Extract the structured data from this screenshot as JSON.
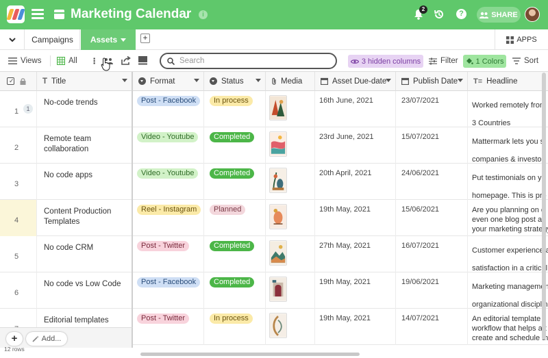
{
  "header": {
    "app_title": "Marketing Calendar",
    "notifications_count": "2",
    "share_label": "SHARE",
    "brand_color": "#5fc86b",
    "icons": [
      "logo-icon",
      "hamburger-menu-icon",
      "table-file-icon",
      "chevron-down-icon",
      "info-icon",
      "bell-icon",
      "history-icon",
      "help-icon",
      "users-icon",
      "avatar"
    ]
  },
  "tabs": {
    "items": [
      {
        "label": "Campaigns",
        "active": false
      },
      {
        "label": "Assets",
        "active": true
      }
    ],
    "add_label": "+",
    "apps_label": "APPS"
  },
  "toolbar": {
    "views_label": "Views",
    "view_name": "All",
    "search_placeholder": "Search",
    "hidden_columns_label": "3 hidden columns",
    "filter_label": "Filter",
    "colors_label": "1 Colors",
    "sort_label": "Sort"
  },
  "columns": [
    "Title",
    "Format",
    "Status",
    "Media",
    "Asset Due-date",
    "Publish Date",
    "Headline"
  ],
  "rows": [
    {
      "num": "1",
      "comments": "1",
      "title": "No-code trends",
      "format": "Post - Facebook",
      "status": "In process",
      "due": "16th June, 2021",
      "publish": "23/07/2021",
      "headline": [
        "Worked remotely from",
        "",
        "3 Countries"
      ]
    },
    {
      "num": "2",
      "comments": "",
      "title": "Remote team collaboration",
      "format": "Video - Youtube",
      "status": "Completed",
      "due": "23rd June, 2021",
      "publish": "15/07/2021",
      "headline": [
        "Mattermark lets you s",
        "",
        "companies & investor"
      ]
    },
    {
      "num": "3",
      "comments": "",
      "title": "No code apps",
      "format": "Video - Youtube",
      "status": "Completed",
      "due": "20th April, 2021",
      "publish": "24/06/2021",
      "headline": [
        "Put testimonials on yo",
        "",
        "homepage. This is pro"
      ]
    },
    {
      "num": "4",
      "comments": "",
      "title": "Content Production Templates",
      "format": "Reel - Instagram",
      "status": "Planned",
      "due": "19th May, 2021",
      "publish": "15/06/2021",
      "headline": [
        "Are you planning on c",
        "even one blog post as p",
        "your marketing strategy"
      ]
    },
    {
      "num": "5",
      "comments": "",
      "title": "No code CRM",
      "format": "Post - Twitter",
      "status": "Completed",
      "due": "27th May, 2021",
      "publish": "16/07/2021",
      "headline": [
        "Customer experience a",
        "",
        "satisfaction in a critical"
      ]
    },
    {
      "num": "6",
      "comments": "",
      "title": "No code vs Low Code",
      "format": "Post - Facebook",
      "status": "Completed",
      "due": "19th May, 2021",
      "publish": "19/06/2021",
      "headline": [
        "Marketing managemen",
        "",
        "organizational disciplin"
      ]
    },
    {
      "num": "7",
      "comments": "",
      "title": "Editorial templates",
      "format": "Post - Twitter",
      "status": "In process",
      "due": "19th May, 2021",
      "publish": "14/07/2021",
      "headline": [
        "An editorial template i",
        "workflow that helps a t",
        "create and schedule th"
      ]
    }
  ],
  "format_colors": {
    "Post - Facebook": {
      "bg": "#cfdff5",
      "fg": "#2a4d7a"
    },
    "Video - Youtube": {
      "bg": "#d2f2c8",
      "fg": "#2e6b26"
    },
    "Reel - Instagram": {
      "bg": "#fbeaa8",
      "fg": "#6b5410"
    },
    "Post - Twitter": {
      "bg": "#f8d3dc",
      "fg": "#7a2a3c"
    }
  },
  "status_colors": {
    "In process": {
      "bg": "#fbeaa8",
      "fg": "#6b5410"
    },
    "Completed": {
      "bg": "#4cb648",
      "fg": "#ffffff"
    },
    "Planned": {
      "bg": "#f3d7dc",
      "fg": "#7a3a47"
    }
  },
  "footer": {
    "add_label": "Add...",
    "row_count": "12 rows"
  }
}
